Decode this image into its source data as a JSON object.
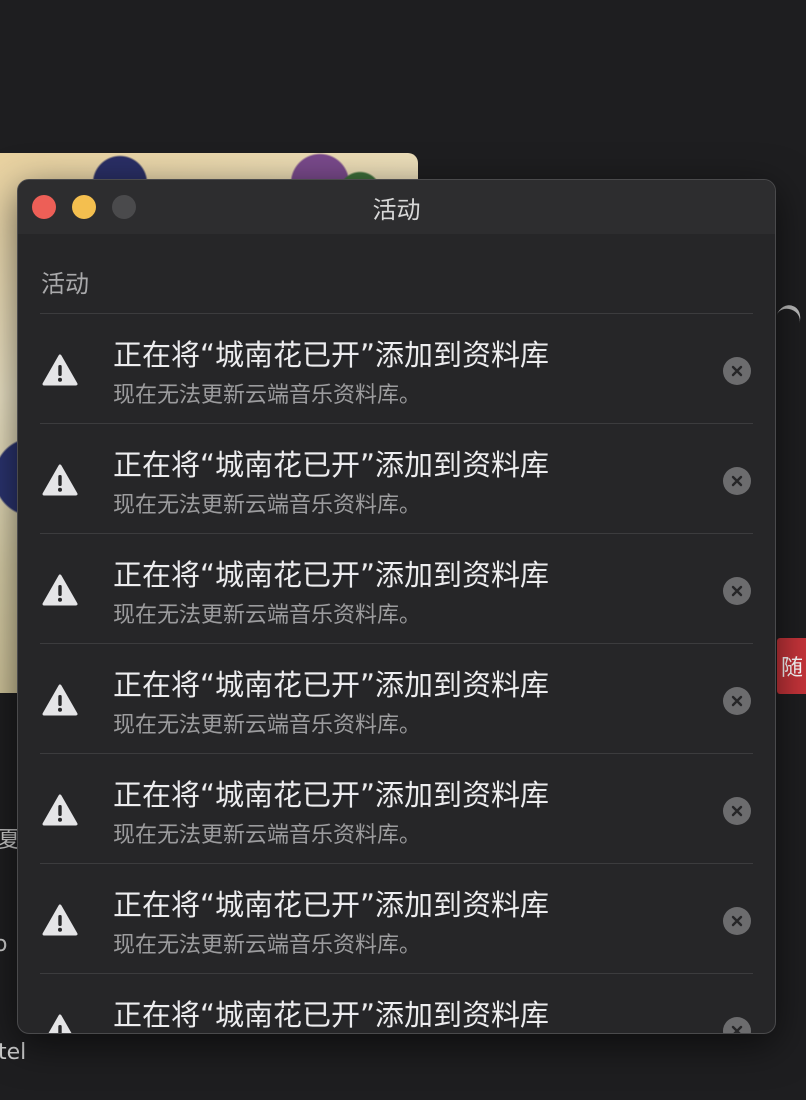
{
  "window": {
    "title": "活动"
  },
  "section": {
    "label": "活动"
  },
  "activities": [
    {
      "title": "正在将“城南花已开”添加到资料库",
      "subtitle": "现在无法更新云端音乐资料库。"
    },
    {
      "title": "正在将“城南花已开”添加到资料库",
      "subtitle": "现在无法更新云端音乐资料库。"
    },
    {
      "title": "正在将“城南花已开”添加到资料库",
      "subtitle": "现在无法更新云端音乐资料库。"
    },
    {
      "title": "正在将“城南花已开”添加到资料库",
      "subtitle": "现在无法更新云端音乐资料库。"
    },
    {
      "title": "正在将“城南花已开”添加到资料库",
      "subtitle": "现在无法更新云端音乐资料库。"
    },
    {
      "title": "正在将“城南花已开”添加到资料库",
      "subtitle": "现在无法更新云端音乐资料库。"
    },
    {
      "title": "正在将“城南花已开”添加到资料库",
      "subtitle": ""
    }
  ],
  "background": {
    "red_button_label": "随",
    "fragment_1": "夏",
    "fragment_2": "o",
    "fragment_3": "tel"
  },
  "colors": {
    "close": "#ed5f57",
    "minimize": "#f4bf4f",
    "zoom_disabled": "#4a4a4c",
    "accent_red": "#c6343a"
  },
  "icons": {
    "row_icon": "warning-triangle-icon",
    "dismiss_icon": "close-circle-icon"
  }
}
